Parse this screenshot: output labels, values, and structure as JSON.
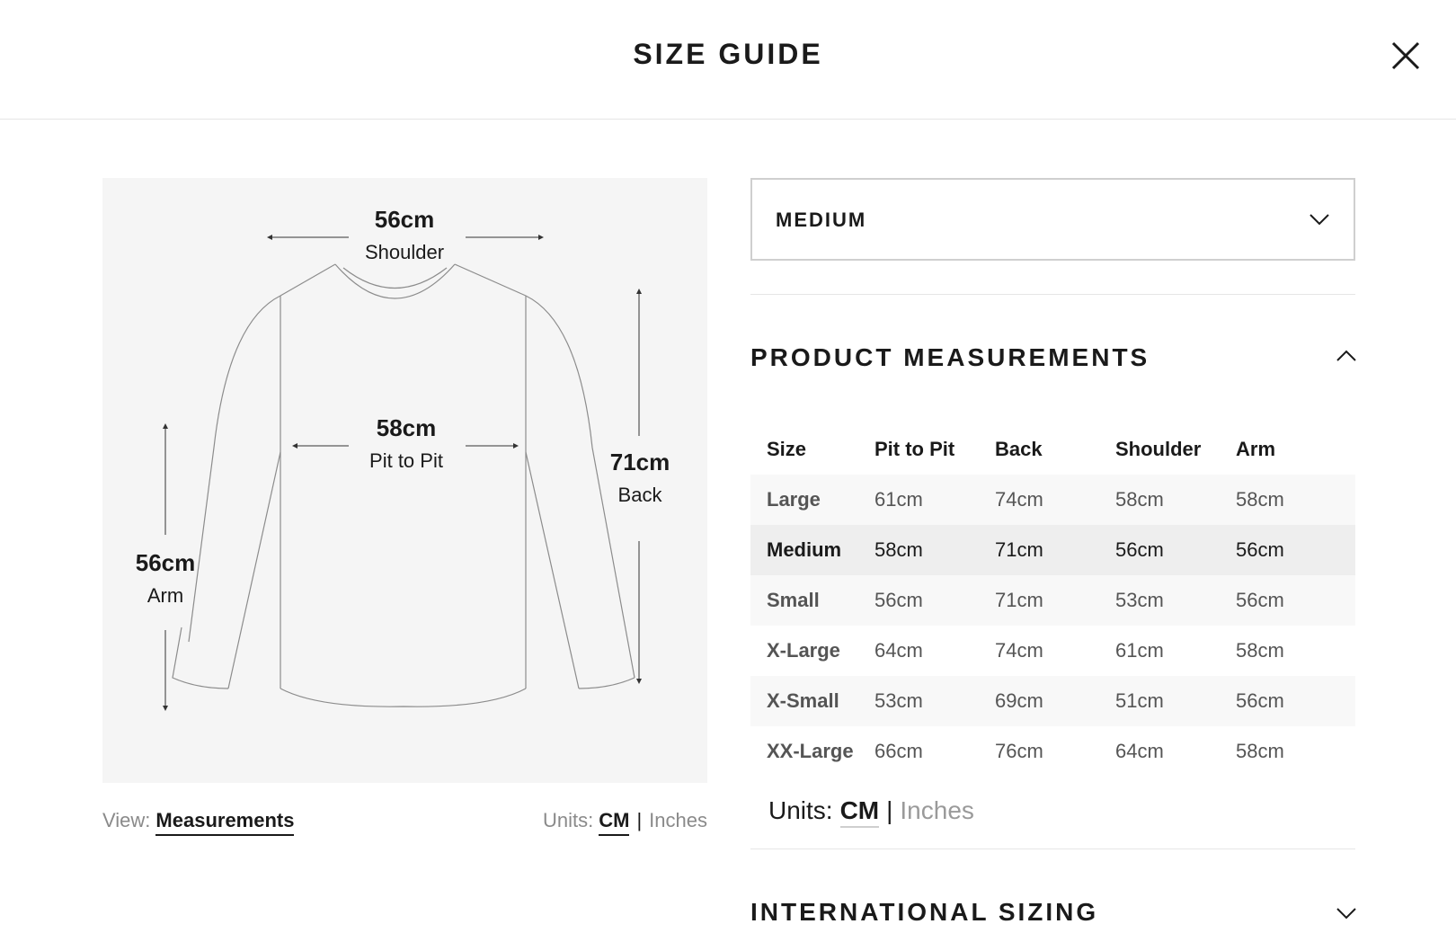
{
  "header": {
    "title": "SIZE GUIDE"
  },
  "diagram": {
    "shoulder": {
      "value": "56cm",
      "label": "Shoulder"
    },
    "pit_to_pit": {
      "value": "58cm",
      "label": "Pit to Pit"
    },
    "back": {
      "value": "71cm",
      "label": "Back"
    },
    "arm": {
      "value": "56cm",
      "label": "Arm"
    }
  },
  "view": {
    "label": "View:",
    "active": "Measurements"
  },
  "units_left": {
    "label": "Units:",
    "active": "CM",
    "separator": "|",
    "inactive": "Inches"
  },
  "size_select": {
    "value": "MEDIUM"
  },
  "product_measurements": {
    "title": "PRODUCT MEASUREMENTS",
    "columns": [
      "Size",
      "Pit to Pit",
      "Back",
      "Shoulder",
      "Arm"
    ],
    "rows": [
      [
        "Large",
        "61cm",
        "74cm",
        "58cm",
        "58cm"
      ],
      [
        "Medium",
        "58cm",
        "71cm",
        "56cm",
        "56cm"
      ],
      [
        "Small",
        "56cm",
        "71cm",
        "53cm",
        "56cm"
      ],
      [
        "X-Large",
        "64cm",
        "74cm",
        "61cm",
        "58cm"
      ],
      [
        "X-Small",
        "53cm",
        "69cm",
        "51cm",
        "56cm"
      ],
      [
        "XX-Large",
        "66cm",
        "76cm",
        "64cm",
        "58cm"
      ]
    ],
    "selected_row": "Medium"
  },
  "units_right": {
    "label": "Units:",
    "active": "CM",
    "separator": "|",
    "inactive": "Inches"
  },
  "international_sizing": {
    "title": "INTERNATIONAL SIZING"
  },
  "colors": {
    "text": "#1a1a1a",
    "muted": "#8a8a8a",
    "panel_bg": "#f5f5f5",
    "selected_row": "#eeeeee"
  }
}
